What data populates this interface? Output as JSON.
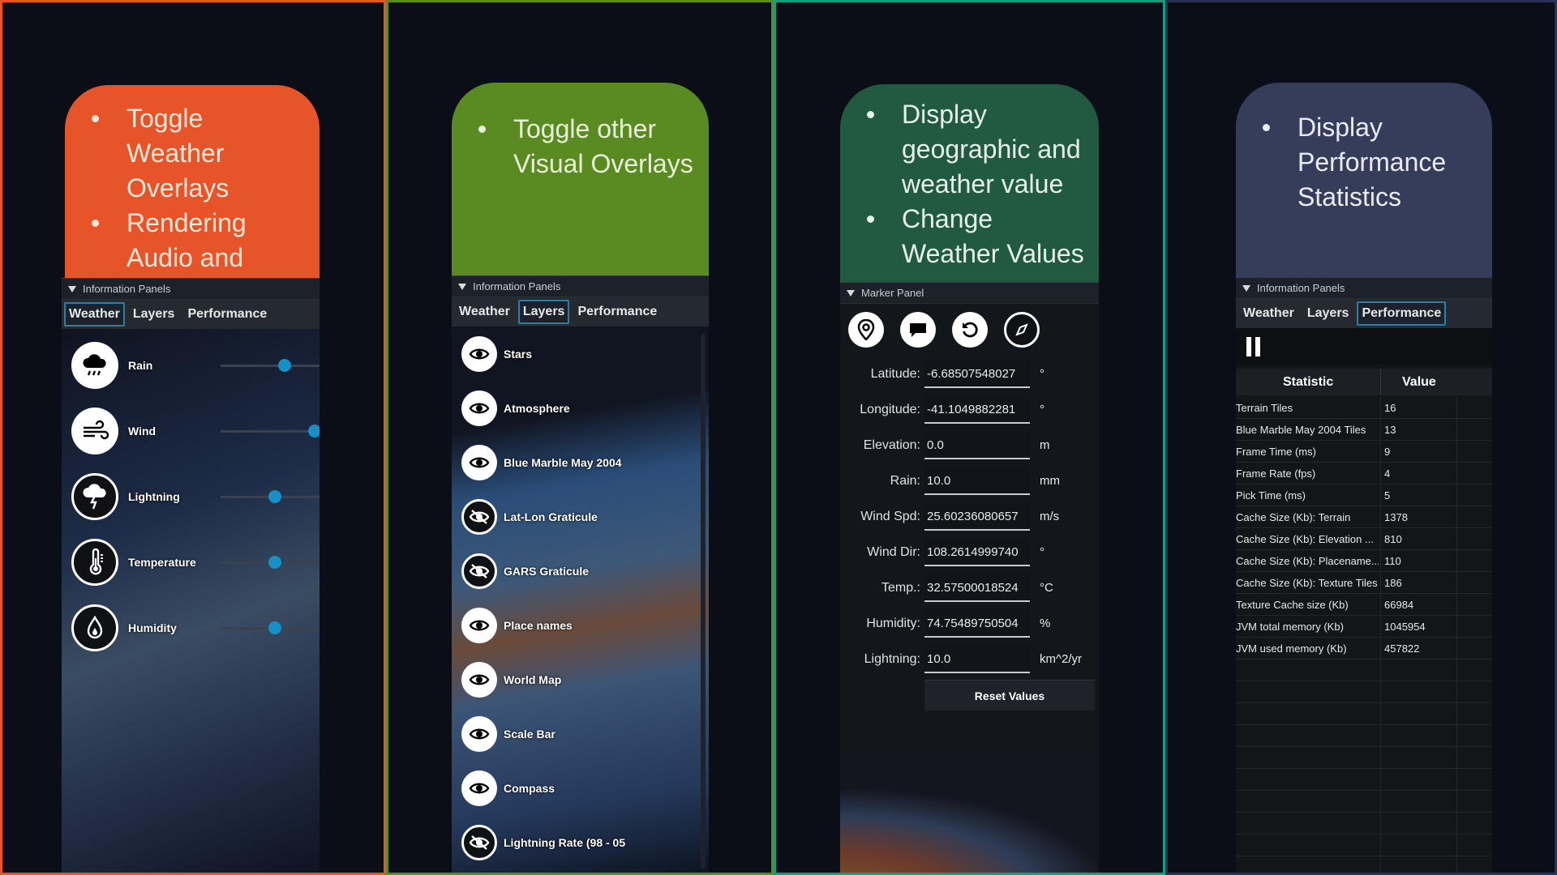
{
  "colors": {
    "orange": "#e8542a",
    "green": "#5a8a22",
    "teal": "#215a40",
    "slate": "#363d5b",
    "accent": "#1591c7"
  },
  "panel1": {
    "bullets": [
      "Toggle Weather Overlays",
      "Rendering Audio and Visuals"
    ],
    "header": "Information Panels",
    "tabs": [
      "Weather",
      "Layers",
      "Performance"
    ],
    "items": [
      {
        "label": "Rain",
        "icon": "rain-cloud-icon",
        "level": 0.65
      },
      {
        "label": "Wind",
        "icon": "wind-icon",
        "level": 0.95
      },
      {
        "label": "Lightning",
        "icon": "lightning-icon",
        "level": 0.55
      },
      {
        "label": "Temperature",
        "icon": "thermometer-icon",
        "level": 0.55
      },
      {
        "label": "Humidity",
        "icon": "droplet-icon",
        "level": 0.55
      }
    ]
  },
  "panel2": {
    "bullets": [
      "Toggle other Visual Overlays"
    ],
    "header": "Information Panels",
    "tabs": [
      "Weather",
      "Layers",
      "Performance"
    ],
    "layers": [
      {
        "label": "Stars",
        "visible": true
      },
      {
        "label": "Atmosphere",
        "visible": true
      },
      {
        "label": "Blue Marble May 2004",
        "visible": true
      },
      {
        "label": "Lat-Lon Graticule",
        "visible": false
      },
      {
        "label": "GARS Graticule",
        "visible": false
      },
      {
        "label": "Place names",
        "visible": true
      },
      {
        "label": "World Map",
        "visible": true
      },
      {
        "label": "Scale Bar",
        "visible": true
      },
      {
        "label": "Compass",
        "visible": true
      },
      {
        "label": "Lightning Rate (98 - 05",
        "visible": false
      }
    ]
  },
  "panel3": {
    "bullets": [
      "Display geographic and weather value",
      "Change Weather Values"
    ],
    "header": "Marker Panel",
    "tools": [
      "map-pin-icon",
      "chat-bubble-icon",
      "rotate-icon",
      "compass-icon"
    ],
    "fields": [
      {
        "label": "Latitude:",
        "value": "-6.68507548027",
        "unit": "°"
      },
      {
        "label": "Longitude:",
        "value": "-41.1049882281",
        "unit": "°"
      },
      {
        "label": "Elevation:",
        "value": "0.0",
        "unit": "m"
      },
      {
        "label": "Rain:",
        "value": "10.0",
        "unit": "mm"
      },
      {
        "label": "Wind Spd:",
        "value": "25.60236080657",
        "unit": "m/s"
      },
      {
        "label": "Wind Dir:",
        "value": "108.2614999740",
        "unit": "°"
      },
      {
        "label": "Temp.:",
        "value": "32.57500018524",
        "unit": "°C"
      },
      {
        "label": "Humidity:",
        "value": "74.75489750504",
        "unit": "%"
      },
      {
        "label": "Lightning:",
        "value": "10.0",
        "unit": "km^2/yr"
      }
    ],
    "reset_label": "Reset Values"
  },
  "panel4": {
    "bullets": [
      "Display Performance Statistics"
    ],
    "header": "Information Panels",
    "tabs": [
      "Weather",
      "Layers",
      "Performance"
    ],
    "col_statistic": "Statistic",
    "col_value": "Value",
    "stats": [
      {
        "name": "Terrain Tiles",
        "value": "16"
      },
      {
        "name": "Blue Marble May 2004 Tiles",
        "value": "13"
      },
      {
        "name": "Frame Time (ms)",
        "value": "9"
      },
      {
        "name": "Frame Rate (fps)",
        "value": "4"
      },
      {
        "name": "Pick Time (ms)",
        "value": "5"
      },
      {
        "name": "Cache Size (Kb): Terrain",
        "value": "1378"
      },
      {
        "name": "Cache Size (Kb): Elevation ...",
        "value": "810"
      },
      {
        "name": "Cache Size (Kb): Placename...",
        "value": "110"
      },
      {
        "name": "Cache Size (Kb): Texture Tiles",
        "value": "186"
      },
      {
        "name": "Texture Cache size (Kb)",
        "value": "66984"
      },
      {
        "name": "JVM total memory (Kb)",
        "value": "1045954"
      },
      {
        "name": "JVM used memory (Kb)",
        "value": "457822"
      }
    ]
  }
}
